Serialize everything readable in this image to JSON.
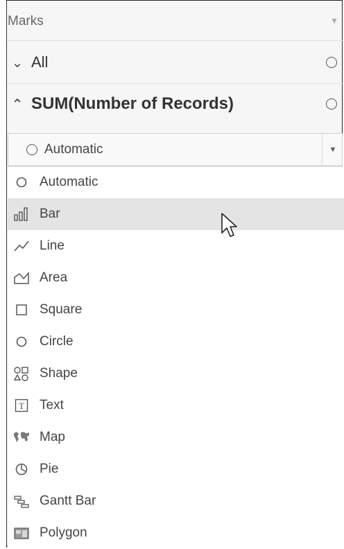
{
  "panel": {
    "title": "Marks",
    "all_label": "All",
    "measure_label": "SUM(Number of Records)"
  },
  "mark_type_dropdown": {
    "selected": "Automatic"
  },
  "menu_items": [
    {
      "label": "Automatic",
      "icon": "circle-outline-icon"
    },
    {
      "label": "Bar",
      "icon": "bar-chart-icon"
    },
    {
      "label": "Line",
      "icon": "line-chart-icon"
    },
    {
      "label": "Area",
      "icon": "area-chart-icon"
    },
    {
      "label": "Square",
      "icon": "square-icon"
    },
    {
      "label": "Circle",
      "icon": "circle-icon"
    },
    {
      "label": "Shape",
      "icon": "shape-icon"
    },
    {
      "label": "Text",
      "icon": "text-icon"
    },
    {
      "label": "Map",
      "icon": "map-icon"
    },
    {
      "label": "Pie",
      "icon": "pie-icon"
    },
    {
      "label": "Gantt Bar",
      "icon": "gantt-bar-icon"
    },
    {
      "label": "Polygon",
      "icon": "polygon-icon"
    }
  ],
  "hovered_item": "Bar"
}
